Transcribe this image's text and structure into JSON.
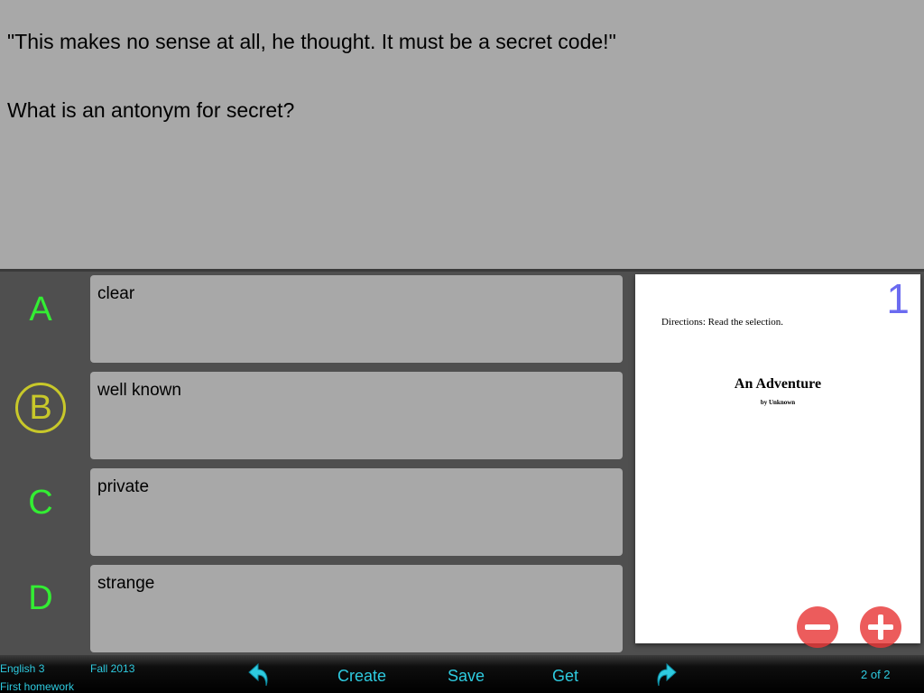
{
  "question": {
    "quote": "\"This makes no sense at all, he thought.  It must be a secret code!\"",
    "prompt": "What is an antonym for secret?"
  },
  "choices": [
    {
      "letter": "A",
      "text": "clear",
      "selected": false
    },
    {
      "letter": "B",
      "text": "well known",
      "selected": true
    },
    {
      "letter": "C",
      "text": "private",
      "selected": false
    },
    {
      "letter": "D",
      "text": "strange",
      "selected": false
    }
  ],
  "document": {
    "page_number": "1",
    "directions": "Directions:  Read the selection.",
    "title": "An Adventure",
    "author": "by Unknown"
  },
  "zoom": {
    "out_icon": "minus-icon",
    "in_icon": "plus-icon"
  },
  "toolbar": {
    "course": "English 3",
    "assignment": "First homework",
    "term": "Fall 2013",
    "back_icon": "undo-arrow-icon",
    "create_label": "Create",
    "save_label": "Save",
    "get_label": "Get",
    "forward_icon": "redo-arrow-icon",
    "page_indicator": "2 of 2"
  },
  "colors": {
    "choice_letter": "#33ee33",
    "selected_ring": "#c8c82a",
    "toolbar_text": "#2ecbe0",
    "page_number": "#6b6bf0",
    "zoom_button": "#e83838"
  }
}
